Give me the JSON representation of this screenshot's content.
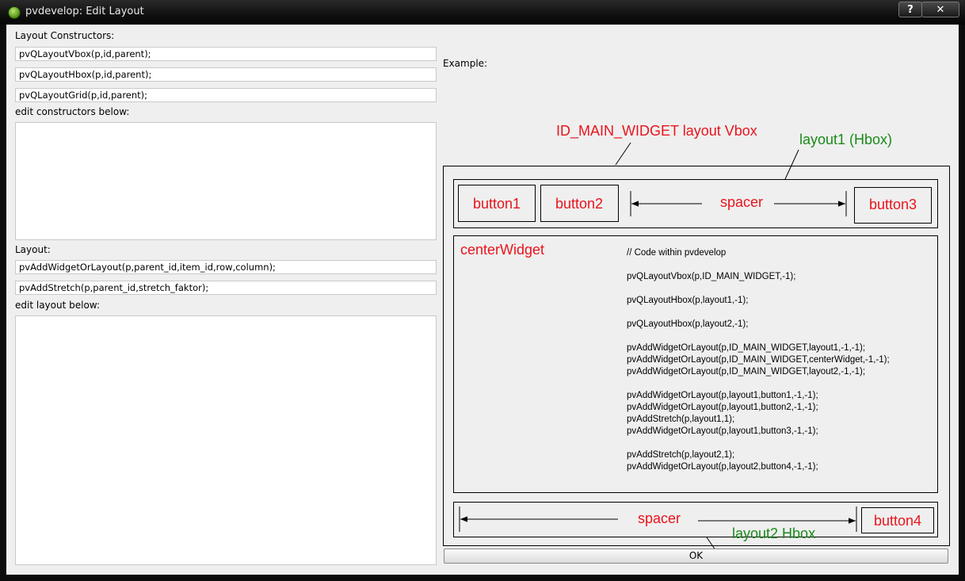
{
  "window": {
    "title": "pvdevelop: Edit Layout",
    "help_label": "?",
    "close_label": "✕"
  },
  "left": {
    "constructors_label": "Layout Constructors:",
    "constructors": [
      "pvQLayoutVbox(p,id,parent);",
      "pvQLayoutHbox(p,id,parent);",
      "pvQLayoutGrid(p,id,parent);"
    ],
    "edit_constructors_label": "edit constructors below:",
    "constructors_text": "",
    "layout_label": "Layout:",
    "layout_functions": [
      "pvAddWidgetOrLayout(p,parent_id,item_id,row,column);",
      "pvAddStretch(p,parent_id,stretch_faktor);"
    ],
    "edit_layout_label": "edit layout below:",
    "layout_text": ""
  },
  "example": {
    "label": "Example:",
    "main_label": "ID_MAIN_WIDGET layout Vbox",
    "layout1_label": "layout1 (Hbox)",
    "layout2_label": "layout2 Hbox",
    "button1": "button1",
    "button2": "button2",
    "button3": "button3",
    "button4": "button4",
    "spacer": "spacer",
    "center_widget": "centerWidget",
    "code": [
      "// Code within pvdevelop",
      "",
      "pvQLayoutVbox(p,ID_MAIN_WIDGET,-1);",
      "",
      "pvQLayoutHbox(p,layout1,-1);",
      "",
      "pvQLayoutHbox(p,layout2,-1);",
      "",
      "pvAddWidgetOrLayout(p,ID_MAIN_WIDGET,layout1,-1,-1);",
      "pvAddWidgetOrLayout(p,ID_MAIN_WIDGET,centerWidget,-1,-1);",
      "pvAddWidgetOrLayout(p,ID_MAIN_WIDGET,layout2,-1,-1);",
      "",
      "pvAddWidgetOrLayout(p,layout1,button1,-1,-1);",
      "pvAddWidgetOrLayout(p,layout1,button2,-1,-1);",
      "pvAddStretch(p,layout1,1);",
      "pvAddWidgetOrLayout(p,layout1,button3,-1,-1);",
      "",
      "pvAddStretch(p,layout2,1);",
      "pvAddWidgetOrLayout(p,layout2,button4,-1,-1);"
    ],
    "colors": {
      "red": "#e8141c",
      "green": "#1a8a1a"
    }
  },
  "ok_label": "OK"
}
